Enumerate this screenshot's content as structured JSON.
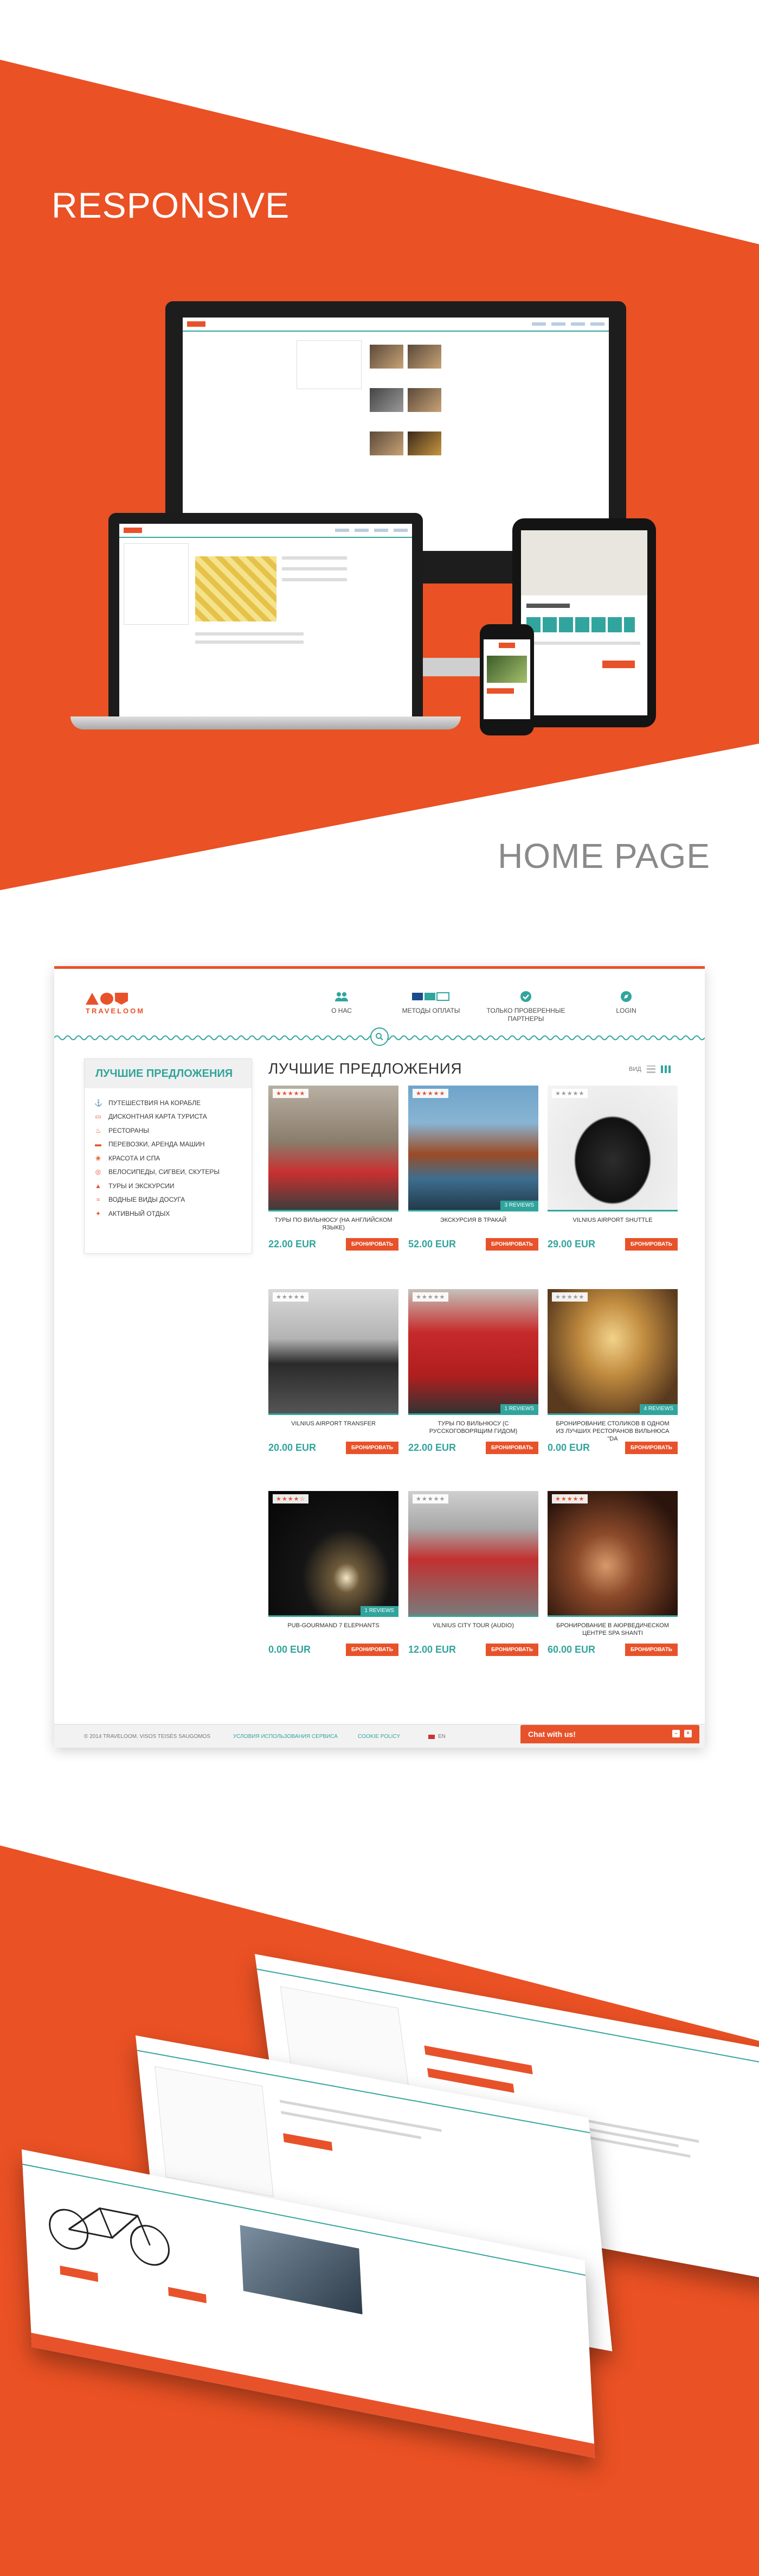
{
  "sections": {
    "responsive_title": "RESPONSIVE",
    "home_title": "HOME PAGE"
  },
  "colors": {
    "accent_orange": "#ea5124",
    "accent_teal": "#31a59d",
    "title_grey": "#8a8a8a"
  },
  "home": {
    "logo_text": "TRAVELOOM",
    "nav": [
      {
        "label": "О НАС",
        "icon": "people-icon"
      },
      {
        "label": "МЕТОДЫ ОПЛАТЫ",
        "icon": "payment-cards-icon"
      },
      {
        "label": "ТОЛЬКО ПРОВЕРЕННЫЕ ПАРТНЕРЫ",
        "icon": "check-circle-icon"
      },
      {
        "label": "LOGIN",
        "icon": "compass-icon"
      }
    ],
    "sidebar": {
      "title": "ЛУЧШИЕ ПРЕДЛОЖЕНИЯ",
      "items": [
        "ПУТЕШЕСТВИЯ НА КОРАБЛЕ",
        "ДИСКОНТНАЯ КАРТА ТУРИСТА",
        "РЕСТОРАНЫ",
        "ПЕРЕВОЗКИ, АРЕНДА МАШИН",
        "КРАСОТА И СПА",
        "ВЕЛОСИПЕДЫ, СИГВЕИ, СКУТЕРЫ",
        "ТУРЫ И ЭКСКУРСИИ",
        "ВОДНЫЕ ВИДЫ ДОСУГА",
        "АКТИВНЫЙ ОТДЫХ"
      ]
    },
    "offers_title": "ЛУЧШИЕ ПРЕДЛОЖЕНИЯ",
    "view_label": "ВИД",
    "book_label": "БРОНИРОВАТЬ",
    "cards": [
      {
        "name": "ТУРЫ ПО ВИЛЬНЮСУ (НА АНГЛИЙСКОМ ЯЗЫКЕ)",
        "price": "22.00 EUR",
        "reviews": "",
        "stars": 5
      },
      {
        "name": "ЭКСКУРСИЯ В ТРАКАЙ",
        "price": "52.00 EUR",
        "reviews": "3 REVIEWS",
        "stars": 5
      },
      {
        "name": "VILNIUS AIRPORT SHUTTLE",
        "price": "29.00 EUR",
        "reviews": "",
        "stars": 0
      },
      {
        "name": "VILNIUS AIRPORT TRANSFER",
        "price": "20.00 EUR",
        "reviews": "",
        "stars": 0
      },
      {
        "name": "ТУРЫ ПО ВИЛЬНЮСУ (С РУССКОГОВОРЯЩИМ ГИДОМ)",
        "price": "22.00 EUR",
        "reviews": "1 REVIEWS",
        "stars": 0
      },
      {
        "name": "БРОНИРОВАНИЕ СТОЛИКОВ В ОДНОМ ИЗ ЛУЧШИХ РЕСТОРАНОВ ВИЛЬНЮСА \"DA",
        "price": "0.00 EUR",
        "reviews": "4 REVIEWS",
        "stars": 0
      },
      {
        "name": "PUB-GOURMAND 7 ELEPHANTS",
        "price": "0.00 EUR",
        "reviews": "1 REVIEWS",
        "stars": 4
      },
      {
        "name": "VILNIUS CITY TOUR (AUDIO)",
        "price": "12.00 EUR",
        "reviews": "",
        "stars": 0
      },
      {
        "name": "БРОНИРОВАНИЕ В АЮРВЕДИЧЕСКОМ ЦЕНТРЕ SPA SHANTI",
        "price": "60.00 EUR",
        "reviews": "",
        "stars": 5
      }
    ],
    "footer": {
      "copyright": "© 2014 TRAVELOOM. VISOS TEISĖS SAUGOMOS",
      "terms": "УСЛОВИЯ ИСПОЛЬЗОВАНИЯ СЕРВИСА",
      "cookie": "COOKIE POLICY",
      "lang": "EN"
    },
    "chat_label": "Chat with us!"
  }
}
